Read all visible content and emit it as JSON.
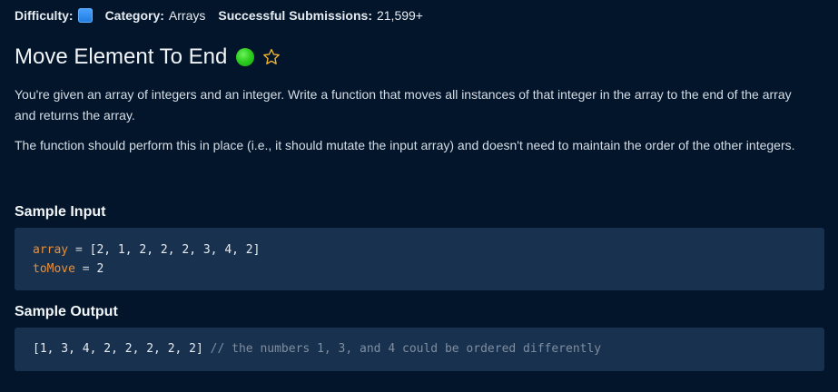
{
  "meta": {
    "difficulty_label": "Difficulty:",
    "category_label": "Category:",
    "category_value": "Arrays",
    "submissions_label": "Successful Submissions:",
    "submissions_value": "21,599+"
  },
  "question": {
    "title": "Move Element To End",
    "paragraphs": [
      "You're given an array of integers and an integer. Write a function that moves all instances of that integer in the array to the end of the array and returns the array.",
      "The function should perform this in place (i.e., it should mutate the input array) and doesn't need to maintain the order of the other integers."
    ]
  },
  "sample_input": {
    "heading": "Sample Input",
    "lines": [
      {
        "name": "array",
        "op": " = ",
        "value": "[2, 1, 2, 2, 2, 3, 4, 2]"
      },
      {
        "name": "toMove",
        "op": " = ",
        "value": "2"
      }
    ]
  },
  "sample_output": {
    "heading": "Sample Output",
    "value": "[1, 3, 4, 2, 2, 2, 2, 2]",
    "comment": " // the numbers 1, 3, and 4 could be ordered differently"
  },
  "colors": {
    "background": "#02152a",
    "code_background": "#18314e",
    "variable": "#e98f38",
    "comment": "#7f8ea0",
    "status_green": "#2fcf22",
    "star": "#f2b632"
  },
  "icons": {
    "difficulty": "difficulty-square-icon",
    "status": "completed-dot-icon",
    "favorite": "star-outline-icon"
  }
}
